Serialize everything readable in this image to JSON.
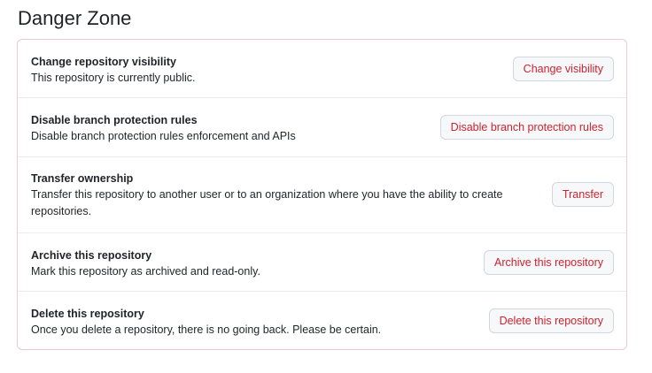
{
  "page": {
    "heading": "Danger Zone"
  },
  "settings": [
    {
      "title": "Change repository visibility",
      "description": "This repository is currently public.",
      "button": "Change visibility"
    },
    {
      "title": "Disable branch protection rules",
      "description": "Disable branch protection rules enforcement and APIs",
      "button": "Disable branch protection rules"
    },
    {
      "title": "Transfer ownership",
      "description": "Transfer this repository to another user or to an organization where you have the ability to create repositories.",
      "button": "Transfer"
    },
    {
      "title": "Archive this repository",
      "description": "Mark this repository as archived and read-only.",
      "button": "Archive this repository"
    },
    {
      "title": "Delete this repository",
      "description": "Once you delete a repository, there is no going back. Please be certain.",
      "button": "Delete this repository"
    }
  ],
  "colors": {
    "danger_text": "#cf222e",
    "danger_border": "#f1c9cd",
    "button_bg": "#f6f8fa"
  }
}
